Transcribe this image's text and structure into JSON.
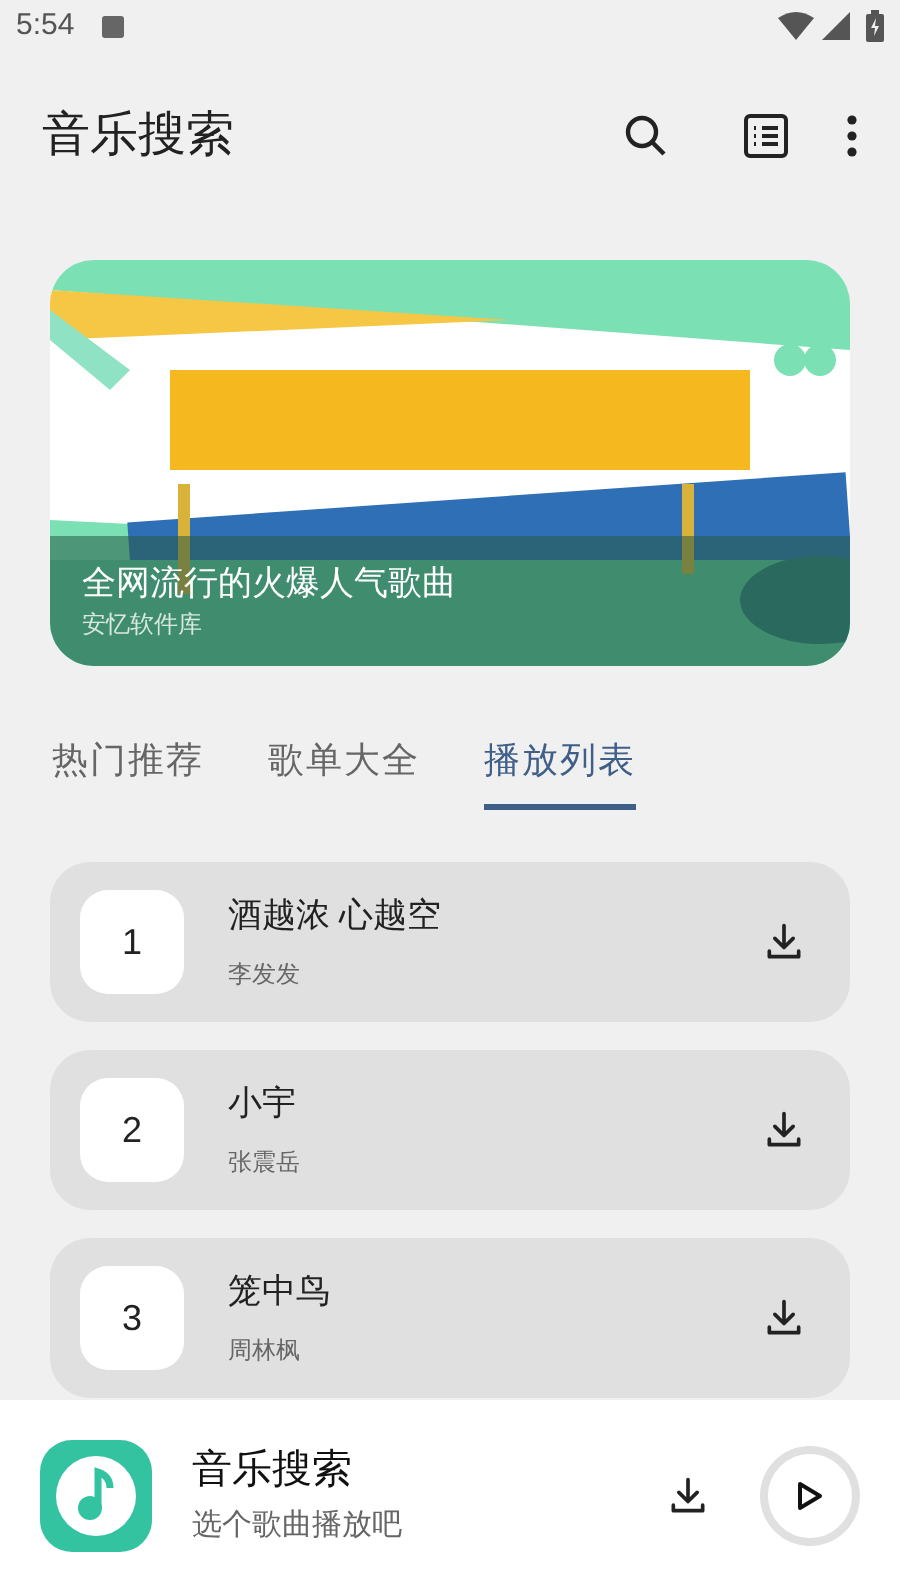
{
  "status_bar": {
    "time": "5:54"
  },
  "app_bar": {
    "title": "音乐搜索"
  },
  "banner": {
    "kind": "picture",
    "caption": "全网流行的火爆人气歌曲",
    "source": "安忆软件库"
  },
  "tabs": [
    {
      "label": "热门推荐",
      "selected": false
    },
    {
      "label": "歌单大全",
      "selected": false
    },
    {
      "label": "播放列表",
      "selected": true
    }
  ],
  "songs": [
    {
      "number": "1",
      "title": "酒越浓 心越空",
      "artist": "李发发"
    },
    {
      "number": "2",
      "title": "小宇",
      "artist": "张震岳"
    },
    {
      "number": "3",
      "title": "笼中鸟",
      "artist": "周林枫"
    }
  ],
  "player": {
    "title": "音乐搜索",
    "subtitle": "选个歌曲播放吧"
  }
}
